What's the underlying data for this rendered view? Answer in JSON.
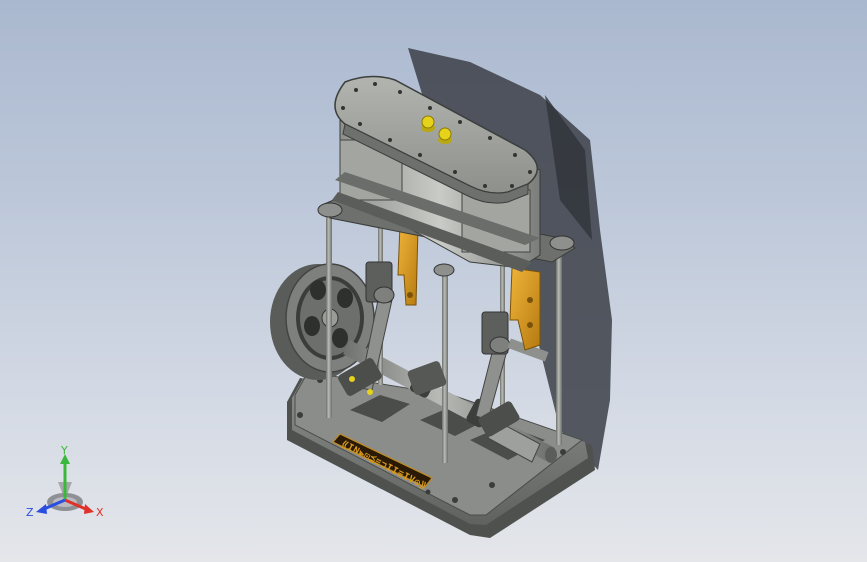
{
  "viewport": {
    "background_top": "#aab8cf",
    "background_bottom": "#e4e6ea"
  },
  "model": {
    "description_icon": "steam-engine-model-icon",
    "nameplate_text": "⟪IN⪢⊡⪳≡⊐II≡IV⊙⟫",
    "colors": {
      "body": "#9a9c98",
      "body_dark": "#5d605d",
      "brass": "#d79a1c",
      "bolt_yellow": "#e6d21a",
      "nameplate": "#2a1a05"
    }
  },
  "triad": {
    "x_label": "X",
    "y_label": "Y",
    "z_label": "Z",
    "x_color": "#e0302a",
    "y_color": "#3ab83a",
    "z_color": "#2a4ee0"
  }
}
